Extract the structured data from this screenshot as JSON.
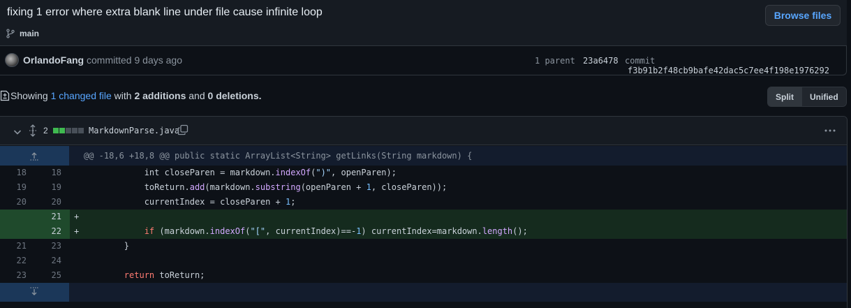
{
  "commit": {
    "title": "fixing 1 error where extra blank line under file cause infinite loop",
    "branch": "main",
    "browse_files_label": "Browse files",
    "author": "OrlandoFang",
    "committed_text": "committed 9 days ago",
    "parent_label": "1 parent",
    "parent_sha": "23a6478",
    "commit_label": "commit",
    "commit_sha": "f3b91b2f48cb9bafe42dac5c7ee4f198e1976292"
  },
  "summary": {
    "showing": "Showing",
    "changed_files": "1 changed file",
    "with": "with",
    "additions": "2 additions",
    "and": "and",
    "deletions": "0 deletions.",
    "split_label": "Split",
    "unified_label": "Unified"
  },
  "file": {
    "change_count": "2",
    "diffstat": [
      "add",
      "add",
      "neutral",
      "neutral",
      "neutral"
    ],
    "name": "MarkdownParse.java",
    "hunk_header": "@@ -18,6 +18,8 @@ public static ArrayList<String> getLinks(String markdown) {",
    "lines": [
      {
        "type": "context",
        "old": "18",
        "new": "18",
        "sign": "",
        "tokens": [
          {
            "t": "            int closeParen = markdown.",
            "c": ""
          },
          {
            "t": "indexOf",
            "c": "fn"
          },
          {
            "t": "(",
            "c": ""
          },
          {
            "t": "\")\"",
            "c": "str"
          },
          {
            "t": ", openParen);",
            "c": ""
          }
        ]
      },
      {
        "type": "context",
        "old": "19",
        "new": "19",
        "sign": "",
        "tokens": [
          {
            "t": "            toReturn.",
            "c": ""
          },
          {
            "t": "add",
            "c": "fn"
          },
          {
            "t": "(markdown.",
            "c": ""
          },
          {
            "t": "substring",
            "c": "fn"
          },
          {
            "t": "(openParen + ",
            "c": ""
          },
          {
            "t": "1",
            "c": "num"
          },
          {
            "t": ", closeParen));",
            "c": ""
          }
        ]
      },
      {
        "type": "context",
        "old": "20",
        "new": "20",
        "sign": "",
        "tokens": [
          {
            "t": "            currentIndex = closeParen + ",
            "c": ""
          },
          {
            "t": "1",
            "c": "num"
          },
          {
            "t": ";",
            "c": ""
          }
        ]
      },
      {
        "type": "add",
        "old": "",
        "new": "21",
        "sign": "+",
        "tokens": [
          {
            "t": "",
            "c": ""
          }
        ]
      },
      {
        "type": "add",
        "old": "",
        "new": "22",
        "sign": "+",
        "tokens": [
          {
            "t": "            ",
            "c": ""
          },
          {
            "t": "if",
            "c": "kw"
          },
          {
            "t": " (markdown.",
            "c": ""
          },
          {
            "t": "indexOf",
            "c": "fn"
          },
          {
            "t": "(",
            "c": ""
          },
          {
            "t": "\"[\"",
            "c": "str"
          },
          {
            "t": ", currentIndex)==-",
            "c": ""
          },
          {
            "t": "1",
            "c": "num"
          },
          {
            "t": ") currentIndex=markdown.",
            "c": ""
          },
          {
            "t": "length",
            "c": "fn"
          },
          {
            "t": "();",
            "c": ""
          }
        ]
      },
      {
        "type": "context",
        "old": "21",
        "new": "23",
        "sign": "",
        "tokens": [
          {
            "t": "        }",
            "c": ""
          }
        ]
      },
      {
        "type": "context",
        "old": "22",
        "new": "24",
        "sign": "",
        "tokens": [
          {
            "t": "",
            "c": ""
          }
        ]
      },
      {
        "type": "context",
        "old": "23",
        "new": "25",
        "sign": "",
        "tokens": [
          {
            "t": "        ",
            "c": ""
          },
          {
            "t": "return",
            "c": "kw"
          },
          {
            "t": " toReturn;",
            "c": ""
          }
        ]
      }
    ]
  },
  "icons": {
    "branch": "git-branch-icon",
    "file_diff": "file-diff-icon",
    "collapse": "chevron-down-icon",
    "expand": "unfold-icon",
    "copy": "copy-icon",
    "menu": "kebab-horizontal-icon",
    "expand_up": "fold-up-icon",
    "expand_down": "fold-down-icon"
  },
  "colors": {
    "link": "#58a6ff",
    "addition": "#3fb950",
    "add_line_bg": "#152b1e",
    "add_gutter_bg": "#1f4a2c",
    "hunk_gutter_bg": "#1b3759"
  }
}
